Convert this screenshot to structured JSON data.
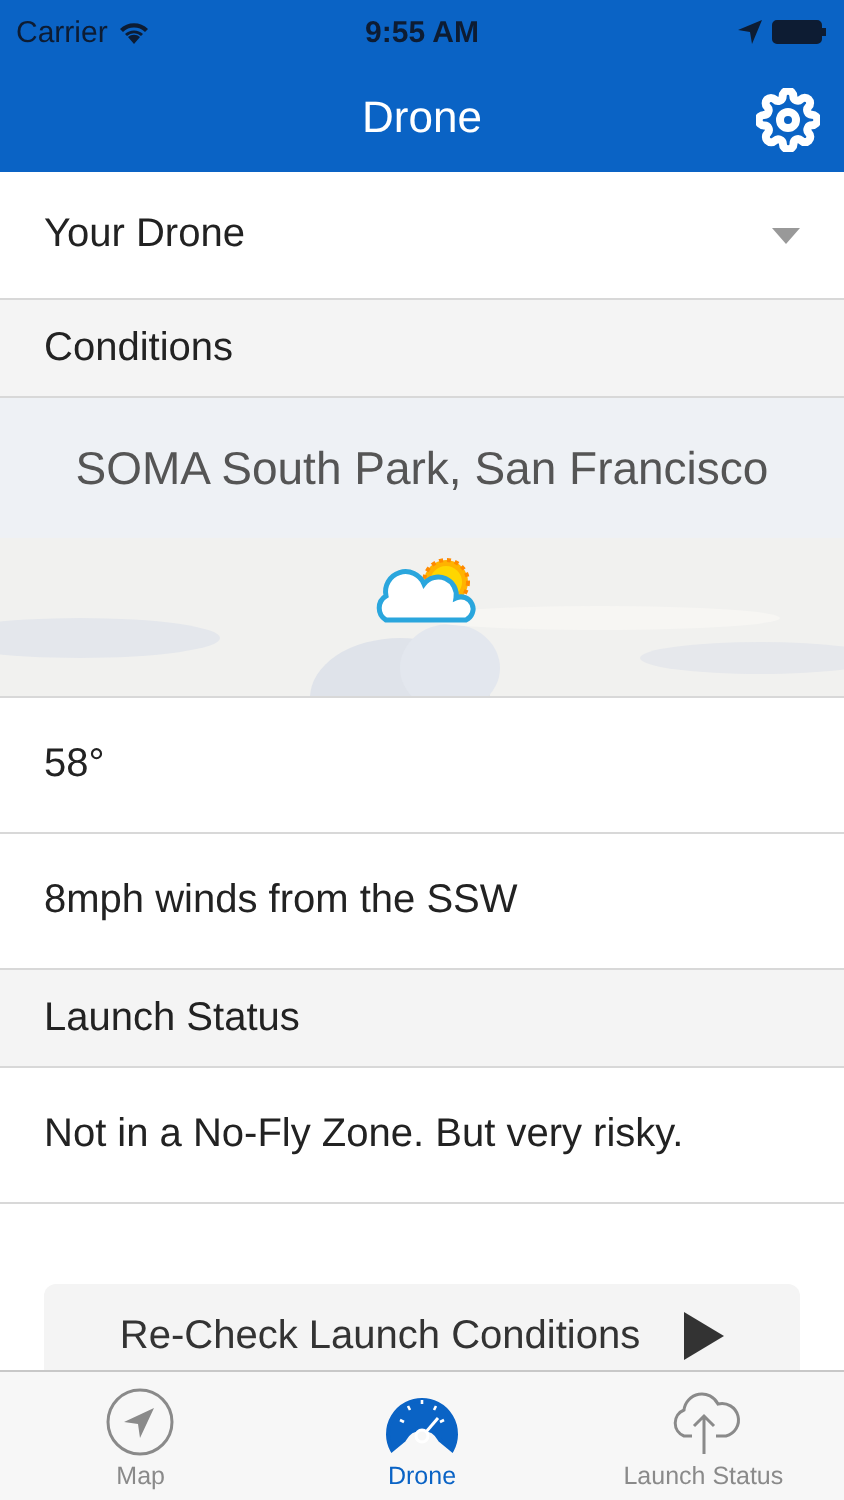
{
  "status_bar": {
    "carrier": "Carrier",
    "time": "9:55 AM"
  },
  "nav": {
    "title": "Drone"
  },
  "drone_select": {
    "label": "Your Drone"
  },
  "conditions": {
    "header": "Conditions",
    "location": "SOMA South Park, San Francisco",
    "temperature": "58°",
    "wind": "8mph winds from the SSW"
  },
  "launch_status": {
    "header": "Launch Status",
    "message": "Not in a No-Fly Zone. But very risky.",
    "button": "Re-Check Launch Conditions"
  },
  "tabs": [
    {
      "label": "Map",
      "kind": "map",
      "selected": false
    },
    {
      "label": "Drone",
      "kind": "drone",
      "selected": true
    },
    {
      "label": "Launch Status",
      "kind": "launch",
      "selected": false
    }
  ]
}
